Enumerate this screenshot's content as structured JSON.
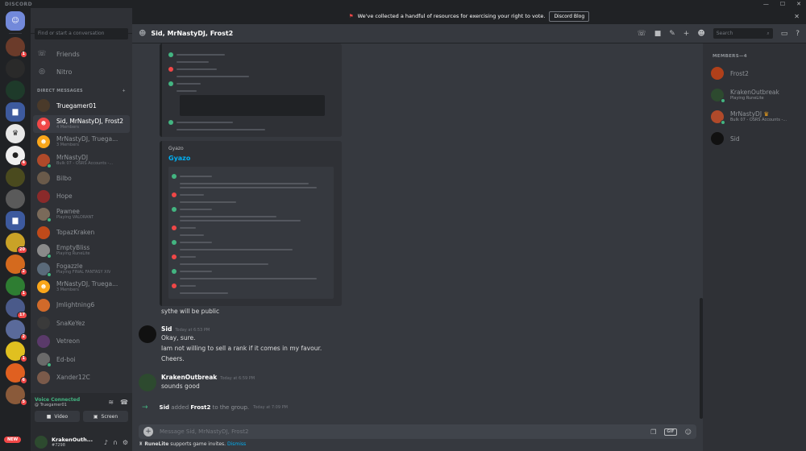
{
  "app": {
    "brand": "DISCORD"
  },
  "notice": {
    "text": "We've collected a handful of resources for exercising your right to vote.",
    "button": "Discord Blog"
  },
  "guilds": {
    "new_label": "NEW",
    "badges": [
      "1",
      "4",
      "20",
      "2",
      "1",
      "17",
      "2",
      "1",
      "6",
      "5"
    ]
  },
  "dm": {
    "search_placeholder": "Find or start a conversation",
    "friends": "Friends",
    "nitro": "Nitro",
    "section_title": "DIRECT MESSAGES",
    "add_symbol": "+",
    "items": [
      {
        "name": "Truegamer01",
        "sub": ""
      },
      {
        "name": "Sid, MrNastyDJ, Frost2",
        "sub": "4 Members"
      },
      {
        "name": "MrNastyDJ, Truega...",
        "sub": "3 Members"
      },
      {
        "name": "MrNastyDJ",
        "sub": "Bulk 07 - OSRS Accounts -..."
      },
      {
        "name": "Bilbo",
        "sub": ""
      },
      {
        "name": "Hope",
        "sub": ""
      },
      {
        "name": "Pawnee",
        "sub": "Playing VALORANT"
      },
      {
        "name": "TopazKraken",
        "sub": ""
      },
      {
        "name": "EmptyBliss",
        "sub": "Playing RuneLite"
      },
      {
        "name": "Fogazzle",
        "sub": "Playing FINAL FANTASY XIV"
      },
      {
        "name": "MrNastyDJ, Truega...",
        "sub": "3 Members"
      },
      {
        "name": "Jmlightning6",
        "sub": ""
      },
      {
        "name": "SnaKeYez",
        "sub": ""
      },
      {
        "name": "Vetreon",
        "sub": ""
      },
      {
        "name": "Ed-boi",
        "sub": ""
      },
      {
        "name": "Xander12C",
        "sub": ""
      }
    ]
  },
  "voice": {
    "title": "Voice Connected",
    "channel": "@ Truegamer01",
    "video": "Video",
    "screen": "Screen"
  },
  "user": {
    "name": "KrakenOuth...",
    "tag": "#7298"
  },
  "chat": {
    "title": "Sid, MrNastyDJ, Frost2",
    "search_placeholder": "Search",
    "gyazo_label": "Gyazo",
    "gyazo_link": "Gyazo",
    "public_line": "sythe will be public",
    "messages": [
      {
        "author": "Sid",
        "time": "Today at 6:53 PM",
        "lines": [
          "Okay, sure.",
          "Iam not willing to sell a rank if it comes in my favour.",
          "Cheers."
        ]
      },
      {
        "author": "KrakenOutbreak",
        "time": "Today at 6:59 PM",
        "lines": [
          "sounds good"
        ]
      }
    ],
    "system": {
      "actor": "Sid",
      "verb": "added",
      "target": "Frost2",
      "rest": "to the group.",
      "time": "Today at 7:09 PM"
    },
    "composer_placeholder": "Message Sid, MrNastyDJ, Frost2",
    "footer": {
      "app": "RuneLite",
      "text": "supports game invites.",
      "dismiss": "Dismiss"
    }
  },
  "members": {
    "header": "MEMBERS—4",
    "items": [
      {
        "name": "Frost2",
        "sub": ""
      },
      {
        "name": "KrakenOutbreak",
        "sub": "Playing RuneLite"
      },
      {
        "name": "MrNastyDJ",
        "sub": "Bulk 07 - OSRS Accounts -..."
      },
      {
        "name": "Sid",
        "sub": ""
      }
    ]
  },
  "colors": {
    "bg": "#36393f",
    "sidebar": "#2f3136",
    "rail": "#202225",
    "online": "#43b581",
    "brand": "#7289da",
    "danger": "#f04747",
    "link": "#00b0f4"
  }
}
